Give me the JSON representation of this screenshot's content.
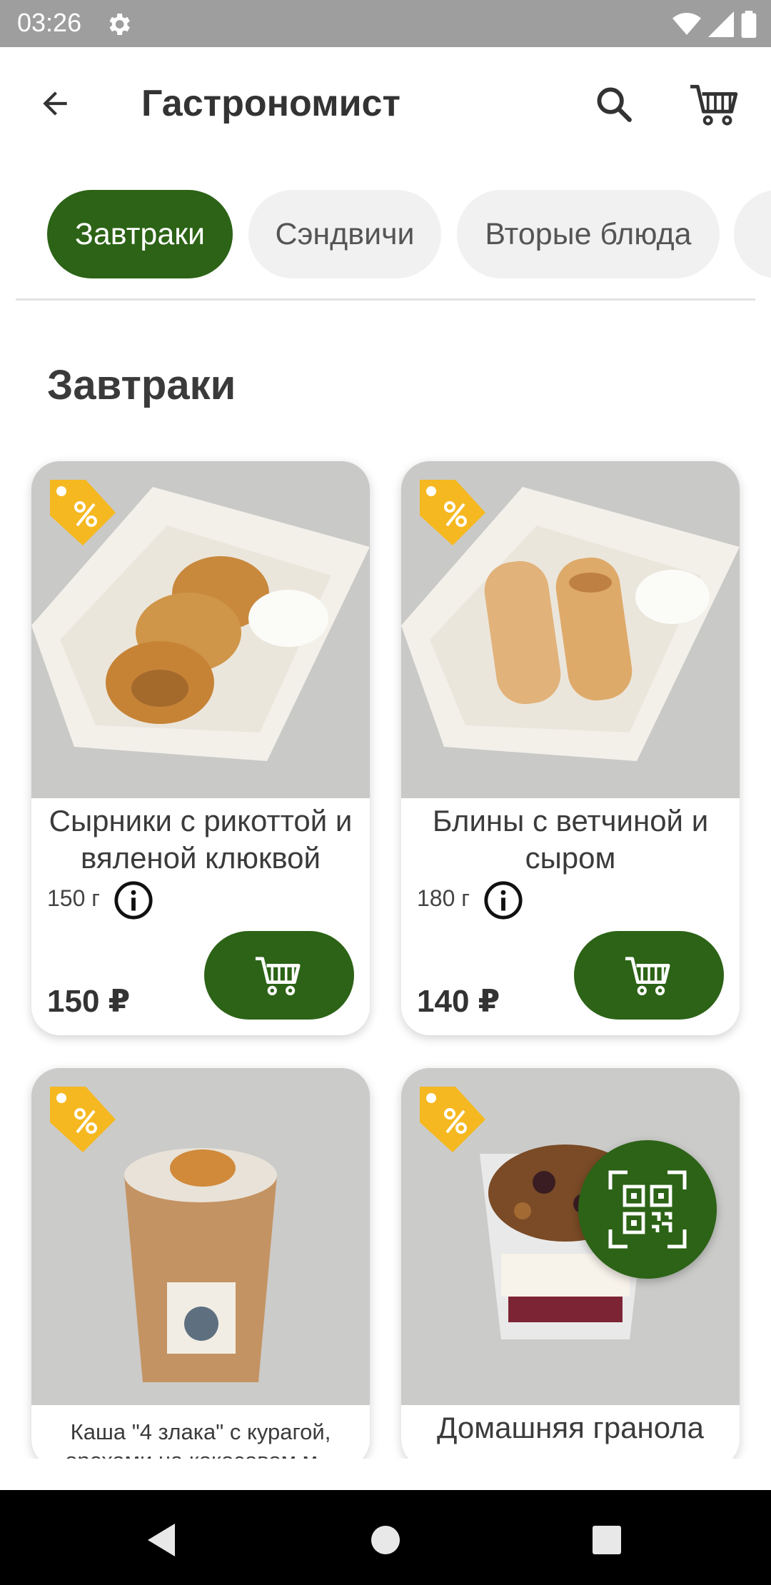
{
  "status_bar": {
    "time": "03:26"
  },
  "app_bar": {
    "title": "Гастрономист"
  },
  "categories": [
    {
      "label": "Завтраки",
      "active": true
    },
    {
      "label": "Сэндвичи",
      "active": false
    },
    {
      "label": "Вторые блюда",
      "active": false
    }
  ],
  "section": {
    "title": "Завтраки"
  },
  "products": [
    {
      "name": "Сырники с рикоттой и вяленой клюквой",
      "weight": "150 г",
      "price": "150 ₽"
    },
    {
      "name": "Блины с ветчиной и сыром",
      "weight": "180 г",
      "price": "140 ₽"
    },
    {
      "name_line1": "Каша \"4 злака\" с курагой,",
      "name_line2": "орехами на кокосовом м..."
    },
    {
      "name": "Домашняя гранола"
    }
  ],
  "colors": {
    "accent": "#2c6316",
    "badge": "#f5b820",
    "chip_bg": "#f1f1f1",
    "status_bar": "#9e9e9e"
  },
  "icons": [
    "back-arrow-icon",
    "search-icon",
    "cart-icon",
    "sale-tag-icon",
    "info-icon",
    "qr-code-icon"
  ]
}
